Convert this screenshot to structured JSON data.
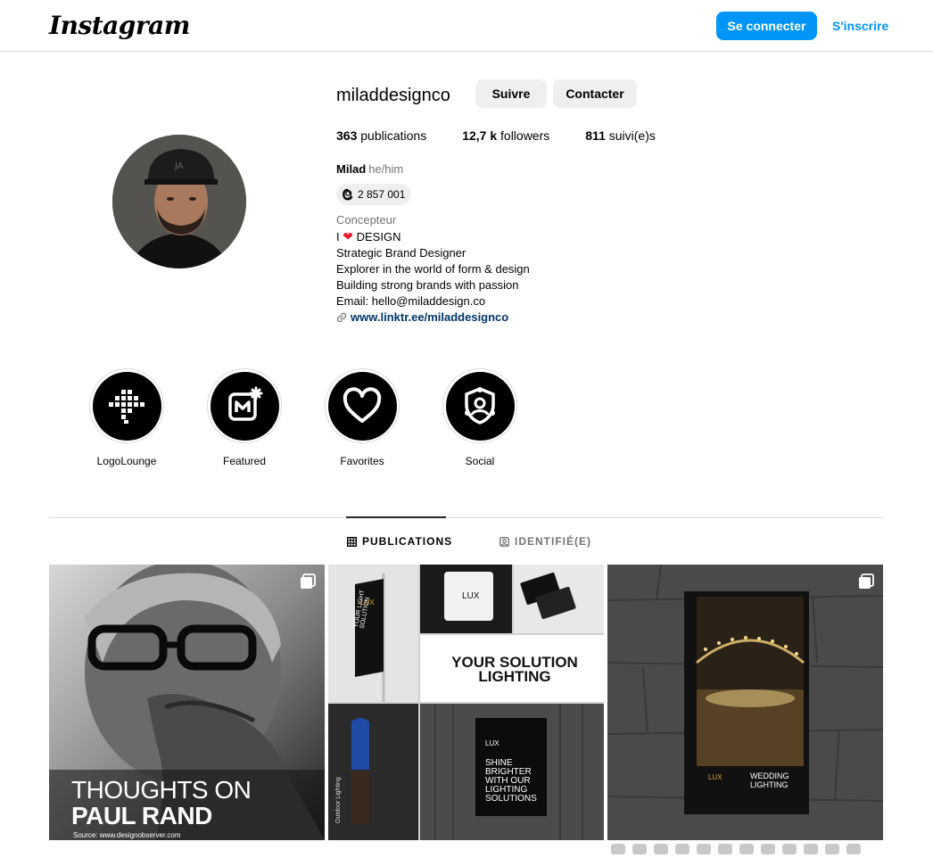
{
  "header": {
    "logo_text": "Instagram",
    "login_label": "Se connecter",
    "signup_label": "S'inscrire"
  },
  "profile": {
    "username": "miladdesignco",
    "follow_label": "Suivre",
    "contact_label": "Contacter",
    "stats": {
      "posts_count": "363",
      "posts_label": "publications",
      "followers_count": "12,7 k",
      "followers_label": "followers",
      "following_count": "811",
      "following_label": "suivi(e)s"
    },
    "name": "Milad",
    "pronouns": "he/him",
    "threads_count": "2 857 001",
    "category": "Concepteur",
    "bio_line1_prefix": "I",
    "bio_line1_suffix": "DESIGN",
    "bio_line2": "Strategic Brand Designer",
    "bio_line3": "Explorer in the world of form & design",
    "bio_line4": "Building strong brands with passion",
    "bio_line5": "Email: hello@miladdesign.co",
    "link": "www.linktr.ee/miladdesignco"
  },
  "highlights": [
    {
      "label": "LogoLounge",
      "icon": "logolounge-icon"
    },
    {
      "label": "Featured",
      "icon": "featured-icon"
    },
    {
      "label": "Favorites",
      "icon": "heart-icon"
    },
    {
      "label": "Social",
      "icon": "social-icon"
    }
  ],
  "tabs": {
    "publications": "PUBLICATIONS",
    "tagged": "IDENTIFIÉ(E)"
  },
  "posts": [
    {
      "line1": "THOUGHTS ON",
      "line2": "PAUL RAND",
      "source": "Source: www.designobserver.com"
    },
    {
      "brand": "LUX",
      "headline1": "YOUR SOLUTION",
      "headline2": "LIGHTING",
      "poster_text": "SHINE BRIGHTER WITH OUR LIGHTING SOLUTIONS",
      "flag_text": "YOUR LIGHT SOLUTION",
      "vertical_text": "Outdoor Lighting"
    },
    {
      "brand": "LUX",
      "title": "WEDDING LIGHTING"
    }
  ],
  "colors": {
    "primary": "#0095f6",
    "link": "#00376b",
    "border": "#dbdbdb",
    "heart": "#ed1f2e"
  }
}
